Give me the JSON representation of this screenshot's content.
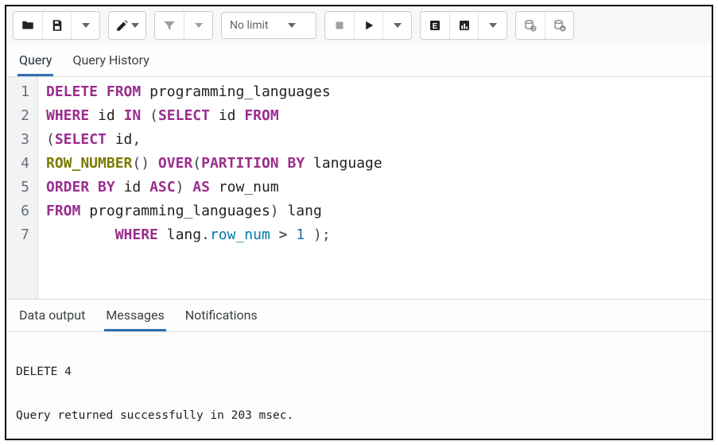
{
  "toolbar": {
    "limit_label": "No limit"
  },
  "tabs": {
    "query": "Query",
    "history": "Query History"
  },
  "editor": {
    "line_numbers": [
      "1",
      "2",
      "3",
      "4",
      "5",
      "6",
      "7"
    ],
    "sql": "DELETE FROM programming_languages\nWHERE id IN (SELECT id FROM\n(SELECT id,\nROW_NUMBER() OVER(PARTITION BY language\nORDER BY id ASC) AS row_num\nFROM programming_languages) lang\n        WHERE lang.row_num > 1 );"
  },
  "output_tabs": {
    "data": "Data output",
    "messages": "Messages",
    "notifications": "Notifications"
  },
  "messages": {
    "line1": "DELETE 4",
    "line2": "Query returned successfully in 203 msec."
  }
}
